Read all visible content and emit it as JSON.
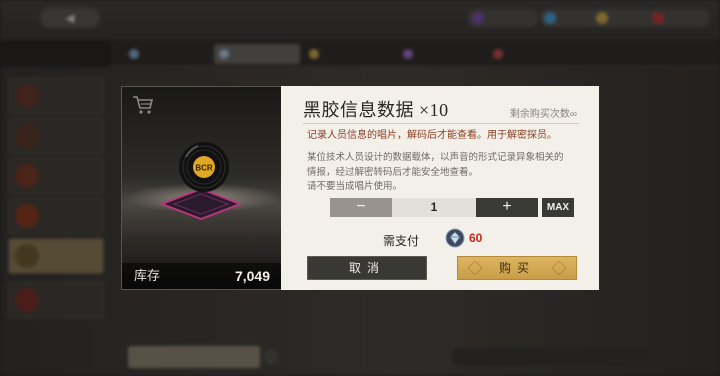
{
  "item_card": {
    "stock_label": "库存",
    "stock_value": "7,049",
    "record_label": "BCR",
    "icon": "shopping-cart-icon"
  },
  "dialog": {
    "title": "黑胶信息数据 ×10",
    "remaining_label": "剩余购买次数∞",
    "short_description": "记录人员信息的唱片，解码后才能查看。用于解密探员。",
    "long_description": [
      "某位技术人员设计的数据载体，以声音的形式记录异象相关的",
      "情报，经过解密转码后才能安全地查看。",
      "请不要当成唱片使用。"
    ],
    "quantity": "1",
    "minus_label": "−",
    "plus_label": "+",
    "max_label": "MAX",
    "pay_label": "需支付",
    "pay_amount": "60",
    "pay_icon": "crystal-currency-icon",
    "cancel_label": "取消",
    "buy_label": "购买"
  },
  "colors": {
    "price_red": "#c1271c",
    "buy_gold": "#d4ad5a",
    "desc_rust": "#8a3e23",
    "record_highlight": "#b8377a"
  }
}
